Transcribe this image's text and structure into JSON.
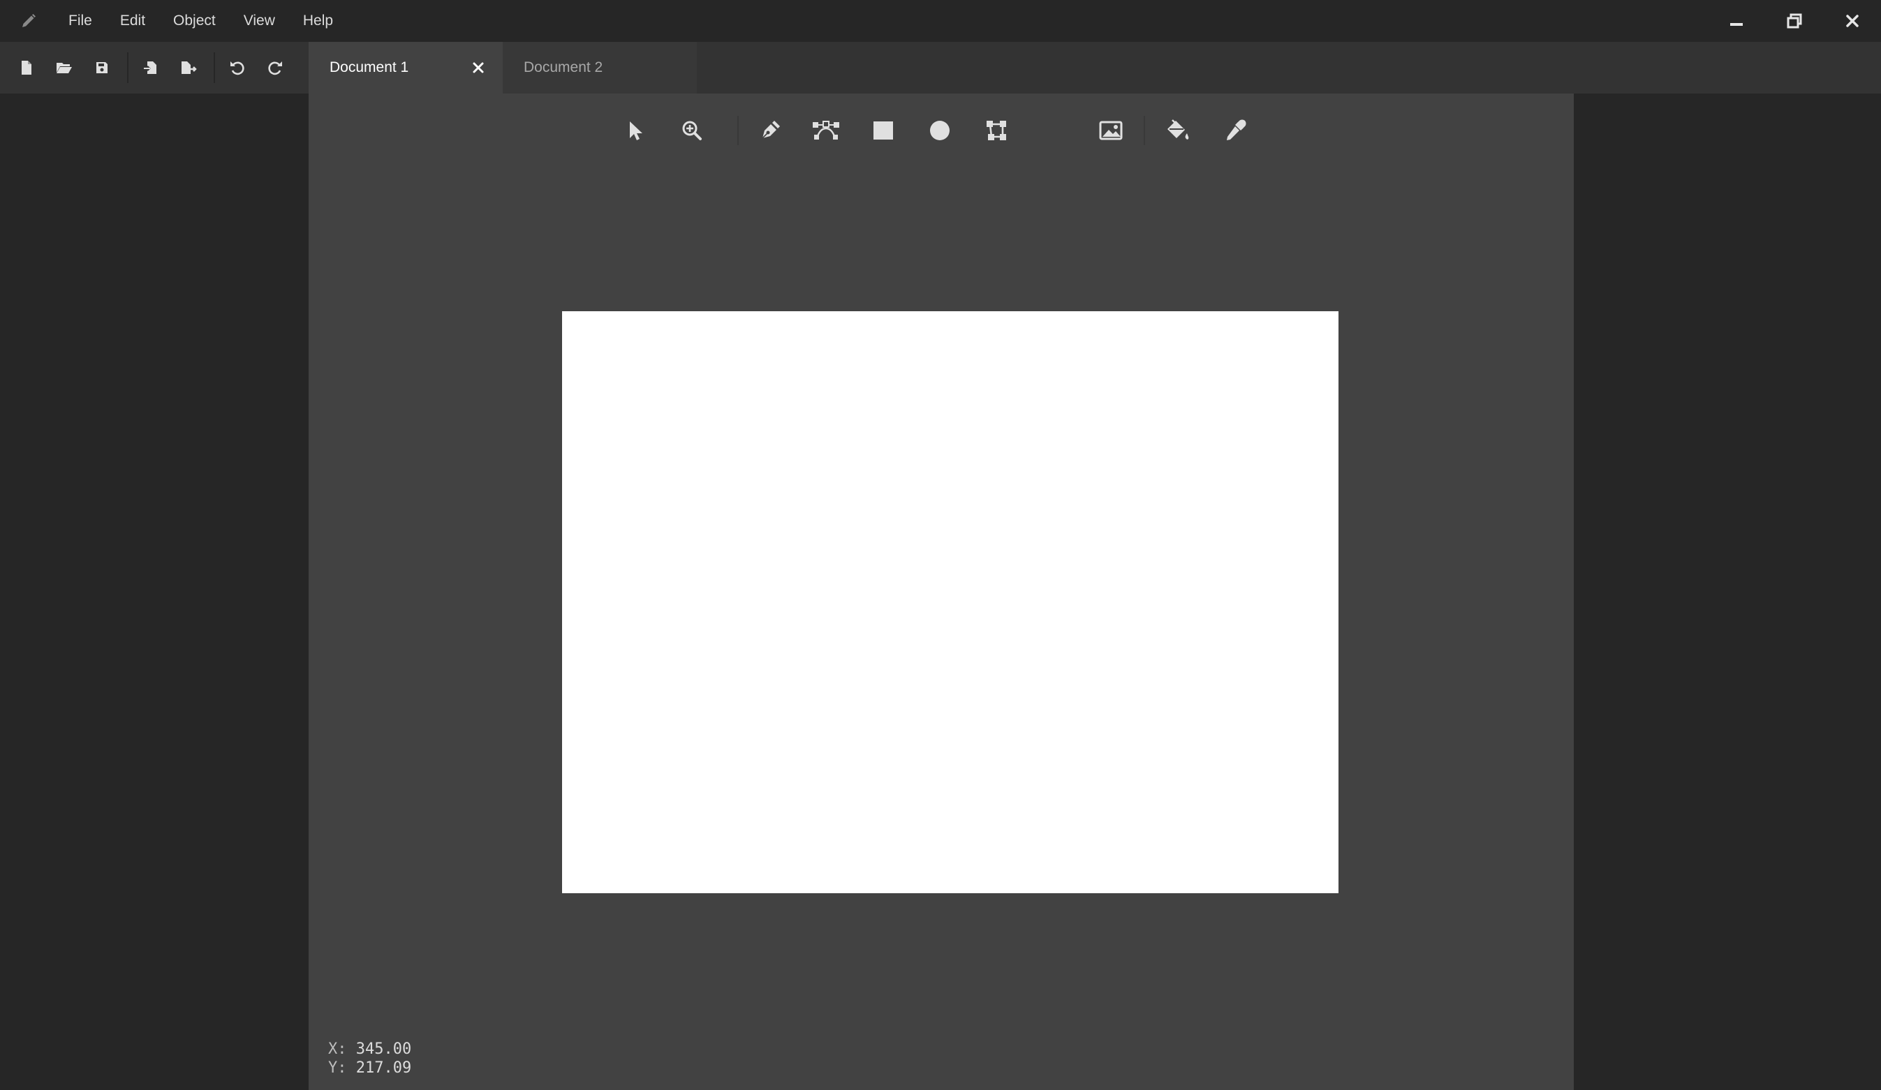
{
  "menu": {
    "file": "File",
    "edit": "Edit",
    "object": "Object",
    "view": "View",
    "help": "Help"
  },
  "tabs": [
    {
      "label": "Document 1",
      "active": true
    },
    {
      "label": "Document 2",
      "active": false
    }
  ],
  "status": {
    "x_label": "X:",
    "x_value": "345.00",
    "y_label": "Y:",
    "y_value": "217.09"
  },
  "icons": {
    "app": "pencil-icon",
    "file_tools": [
      "new-file-icon",
      "open-folder-icon",
      "save-icon",
      "import-icon",
      "export-icon",
      "undo-icon",
      "redo-icon"
    ],
    "draw_tools": [
      "select-arrow-icon",
      "zoom-in-icon",
      "pen-icon",
      "node-edit-icon",
      "rectangle-icon",
      "ellipse-icon",
      "transform-icon",
      "image-icon",
      "paint-bucket-icon",
      "eyedropper-icon"
    ]
  },
  "colors": {
    "titlebar": "#262626",
    "toolbar": "#333333",
    "workspace": "#424242",
    "canvas": "#ffffff",
    "icon": "#e0e0e0"
  }
}
